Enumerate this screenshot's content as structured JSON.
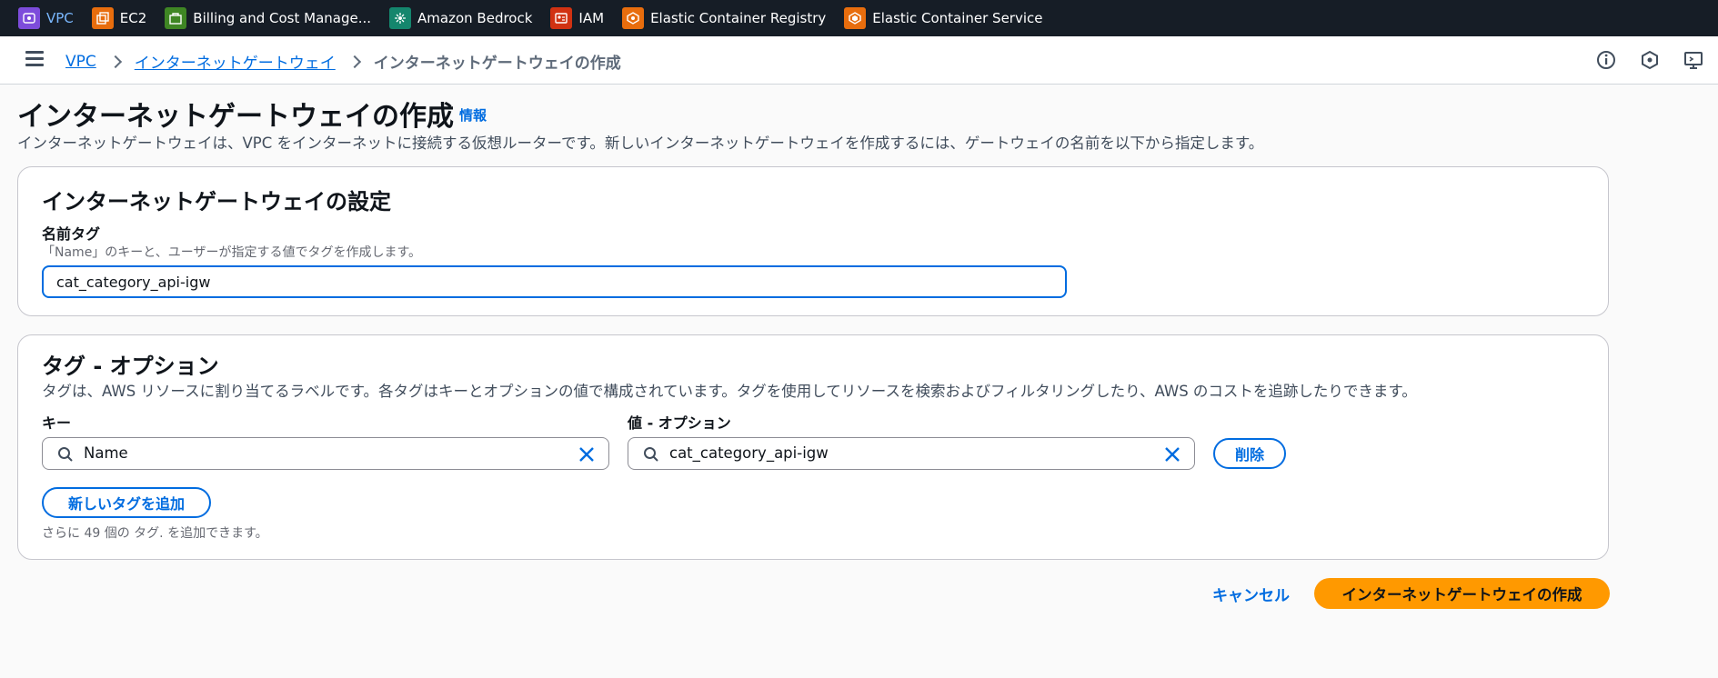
{
  "top_nav": {
    "favorites": [
      {
        "label": "VPC",
        "icon": "vpc-icon",
        "color": "#7d4cdb",
        "active": true
      },
      {
        "label": "EC2",
        "icon": "ec2-icon",
        "color": "#e86d0d"
      },
      {
        "label": "Billing and Cost Manage...",
        "icon": "billing-icon",
        "color": "#3f8624"
      },
      {
        "label": "Amazon Bedrock",
        "icon": "bedrock-icon",
        "color": "#14866d"
      },
      {
        "label": "IAM",
        "icon": "iam-icon",
        "color": "#d13212"
      },
      {
        "label": "Elastic Container Registry",
        "icon": "ecr-icon",
        "color": "#e86d0d"
      },
      {
        "label": "Elastic Container Service",
        "icon": "ecs-icon",
        "color": "#e86d0d"
      }
    ]
  },
  "breadcrumb": {
    "items": [
      "VPC",
      "インターネットゲートウェイ"
    ],
    "current": "インターネットゲートウェイの作成"
  },
  "header": {
    "title": "インターネットゲートウェイの作成",
    "info": "情報",
    "description": "インターネットゲートウェイは、VPC をインターネットに接続する仮想ルーターです。新しいインターネットゲートウェイを作成するには、ゲートウェイの名前を以下から指定します。"
  },
  "settings": {
    "title": "インターネットゲートウェイの設定",
    "name_tag_label": "名前タグ",
    "name_tag_hint": "「Name」のキーと、ユーザーが指定する値でタグを作成します。",
    "name_tag_value": "cat_category_api-igw"
  },
  "tags": {
    "title": "タグ - オプション",
    "description": "タグは、AWS リソースに割り当てるラベルです。各タグはキーとオプションの値で構成されています。タグを使用してリソースを検索およびフィルタリングしたり、AWS のコストを追跡したりできます。",
    "key_label": "キー",
    "value_label": "値 - オプション",
    "key_value": "Name",
    "value_value": "cat_category_api-igw",
    "remove_label": "削除",
    "add_label": "新しいタグを追加",
    "limit_note": "さらに 49 個の タグ. を追加できます。"
  },
  "actions": {
    "cancel": "キャンセル",
    "create": "インターネットゲートウェイの作成"
  },
  "colors": {
    "accent": "#006ce0",
    "primary_button": "#ff9900",
    "topbar": "#161d26"
  }
}
